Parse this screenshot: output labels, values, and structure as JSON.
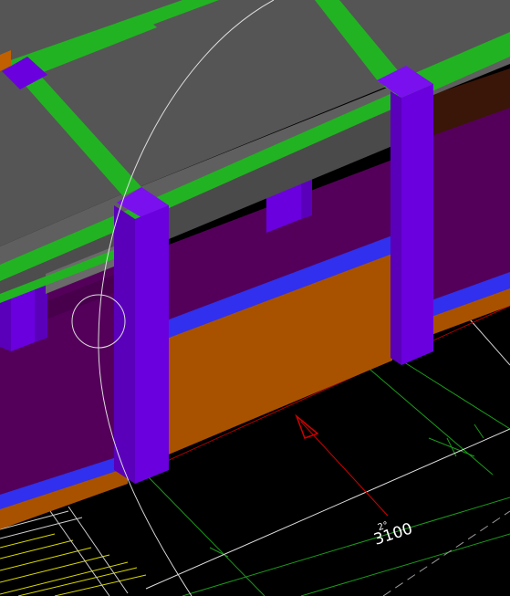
{
  "viewport": {
    "background": "#000000",
    "dimension_text": "3100",
    "dimension_superscript": "2°"
  },
  "colors": {
    "roof_slab": "#555555",
    "roof_edge": "#6e6e6e",
    "beam_green": "#22b322",
    "column_purple": "#6a00dd",
    "column_side": "#5a00bb",
    "wall_magenta": "#54005a",
    "wall_dark": "#3e003f",
    "orange_panel": "#a85200",
    "blue_strip": "#3030ee",
    "grid_green": "#1a9a1a",
    "yellow_lines": "#d8d800",
    "red_arrow": "#d00000",
    "white_line": "#e0e0e0"
  },
  "icons": {
    "orbit_cursor": "orbit-circle-icon",
    "direction_arrow": "north-arrow-icon"
  }
}
